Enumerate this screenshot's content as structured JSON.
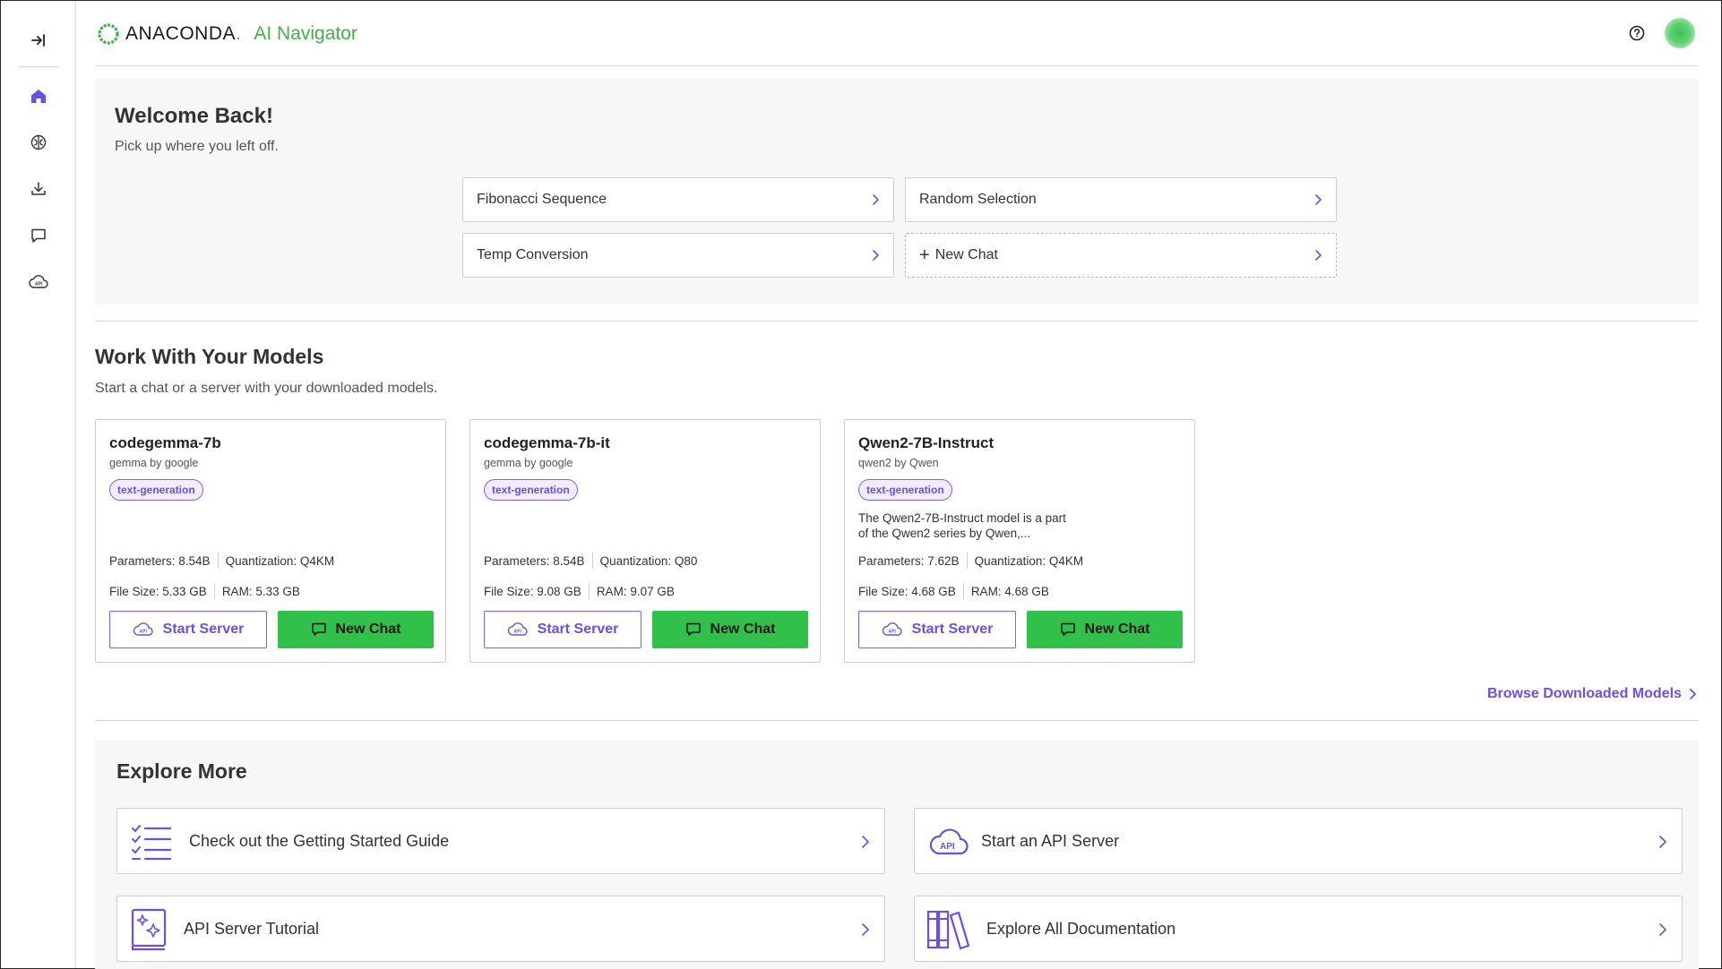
{
  "app": {
    "brand": "ANACONDA",
    "brand_dot": ".",
    "product": "AI Navigator"
  },
  "sidebar": {
    "items": [
      {
        "name": "home",
        "icon": "home-icon",
        "active": true
      },
      {
        "name": "models",
        "icon": "brain-icon",
        "active": false
      },
      {
        "name": "downloads",
        "icon": "download-icon",
        "active": false
      },
      {
        "name": "chat",
        "icon": "chat-icon",
        "active": false
      },
      {
        "name": "api-server",
        "icon": "api-cloud-icon",
        "active": false
      }
    ]
  },
  "welcome": {
    "title": "Welcome Back!",
    "subtitle": "Pick up where you left off.",
    "recent": [
      {
        "label": "Fibonacci Sequence"
      },
      {
        "label": "Random Selection"
      },
      {
        "label": "Temp Conversion"
      },
      {
        "label": "New Chat"
      }
    ]
  },
  "models": {
    "title": "Work With Your Models",
    "subtitle": "Start a chat or a server with your downloaded models.",
    "cards": [
      {
        "name": "codegemma-7b",
        "org": "gemma by google",
        "tag": "text-generation",
        "description": "",
        "params": "Parameters: 8.54B",
        "quant": "Quantization: Q4KM",
        "size": "File Size: 5.33 GB",
        "ram": "RAM: 5.33 GB"
      },
      {
        "name": "codegemma-7b-it",
        "org": "gemma by google",
        "tag": "text-generation",
        "description": "",
        "params": "Parameters: 8.54B",
        "quant": "Quantization: Q80",
        "size": "File Size: 9.08 GB",
        "ram": "RAM: 9.07 GB"
      },
      {
        "name": "Qwen2-7B-Instruct",
        "org": "qwen2 by Qwen",
        "tag": "text-generation",
        "description": "The Qwen2-7B-Instruct model is a part of the Qwen2 series by Qwen,...",
        "params": "Parameters: 7.62B",
        "quant": "Quantization: Q4KM",
        "size": "File Size: 4.68 GB",
        "ram": "RAM: 4.68 GB"
      }
    ],
    "start_server_label": "Start Server",
    "new_chat_label": "New Chat",
    "browse_label": "Browse Downloaded Models"
  },
  "explore": {
    "title": "Explore More",
    "items": [
      {
        "label": "Check out the Getting Started Guide",
        "icon": "checklist-icon"
      },
      {
        "label": "Start an API Server",
        "icon": "api-cloud-icon"
      },
      {
        "label": "API Server Tutorial",
        "icon": "book-sparkle-icon"
      },
      {
        "label": "Explore All Documentation",
        "icon": "books-icon"
      }
    ]
  },
  "colors": {
    "accent": "#6b4fe8",
    "green": "#31c04a",
    "brand_green": "#43b049"
  }
}
